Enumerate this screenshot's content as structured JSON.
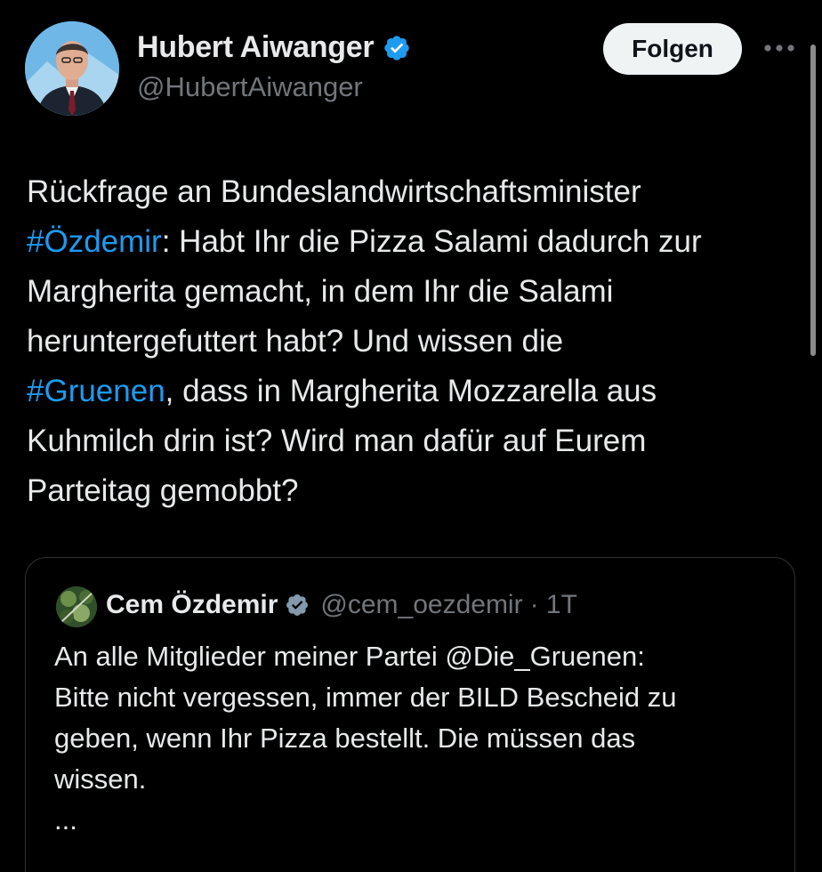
{
  "author": {
    "name": "Hubert Aiwanger",
    "handle": "@HubertAiwanger",
    "verified": true,
    "avatar": "profile-photo"
  },
  "header": {
    "follow_label": "Folgen",
    "more_icon": "more-horizontal-icon"
  },
  "tweet": {
    "lines": [
      {
        "pre": "Rückfrage an Bundeslandwirtschaftsminister",
        "tag": "",
        "post": ""
      },
      {
        "pre": "",
        "tag": "#Özdemir",
        "post": ": Habt Ihr die Pizza Salami dadurch zur"
      },
      {
        "pre": "Margherita gemacht, in dem Ihr die Salami",
        "tag": "",
        "post": ""
      },
      {
        "pre": "heruntergefuttert habt? Und wissen die",
        "tag": "",
        "post": ""
      },
      {
        "pre": "",
        "tag": "#Gruenen",
        "post": ", dass in Margherita Mozzarella aus"
      },
      {
        "pre": "Kuhmilch drin ist? Wird man dafür auf Eurem",
        "tag": "",
        "post": ""
      },
      {
        "pre": "Parteitag gemobbt?",
        "tag": "",
        "post": ""
      }
    ]
  },
  "quoted_tweet": {
    "name": "Cem Özdemir",
    "handle": "@cem_oezdemir",
    "time": "· 1T",
    "verified": true,
    "lines": [
      "An alle Mitglieder meiner Partei @Die_Gruenen:",
      "Bitte nicht vergessen, immer der BILD Bescheid zu",
      "geben, wenn Ihr Pizza bestellt. Die müssen das",
      "wissen.",
      "..."
    ]
  },
  "colors": {
    "background": "#000000",
    "text": "#e7e9ea",
    "secondary": "#71767b",
    "accent": "#1d9bf0",
    "border": "#2f3336"
  }
}
